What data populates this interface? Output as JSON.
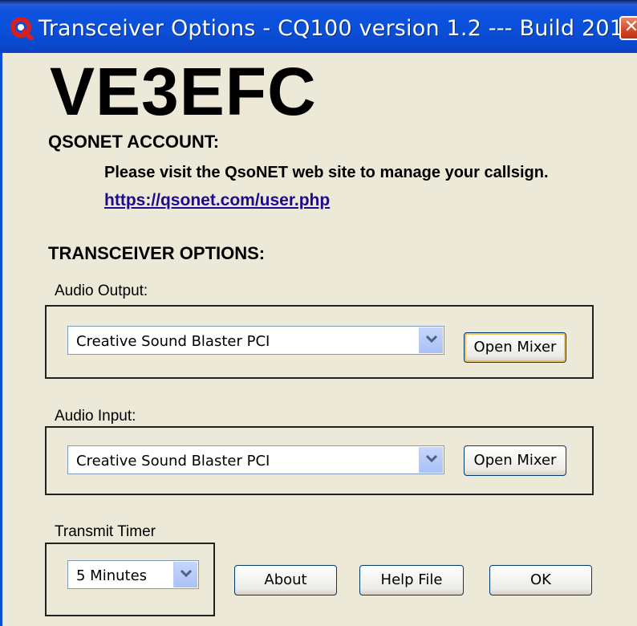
{
  "window": {
    "title": "Transceiver  Options - CQ100 version 1.2 --- Build 201",
    "close_glyph": "✕"
  },
  "header": {
    "callsign": "VE3EFC"
  },
  "account": {
    "heading": "QSONET ACCOUNT:",
    "message": "Please visit the QsoNET web site to manage your callsign.",
    "link": "https://qsonet.com/user.php"
  },
  "transceiver": {
    "heading": "TRANSCEIVER OPTIONS:",
    "audio_output": {
      "label": "Audio Output:",
      "selected": "Creative Sound Blaster PCI",
      "mixer_button": "Open Mixer"
    },
    "audio_input": {
      "label": "Audio Input:",
      "selected": "Creative Sound Blaster PCI",
      "mixer_button": "Open Mixer"
    },
    "transmit_timer": {
      "label": "Transmit Timer",
      "selected": "5  Minutes"
    }
  },
  "buttons": {
    "about": "About",
    "help": "Help File",
    "ok": "OK"
  },
  "icons": {
    "app": "q-logo-icon",
    "close": "close-icon",
    "dropdown": "chevron-down-icon"
  },
  "colors": {
    "titlebar": "#0b4fd8",
    "window_bg": "#ece9d8",
    "link": "#1d0b8f",
    "close_button": "#d24a25"
  }
}
